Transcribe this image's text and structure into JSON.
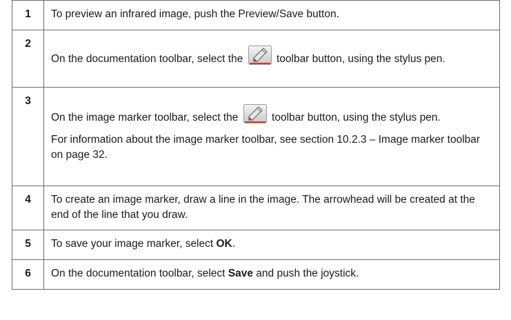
{
  "steps": [
    {
      "number": "1",
      "text": "To preview an infrared image, push the Preview/Save button."
    },
    {
      "number": "2",
      "text_before": "On the documentation toolbar, select the",
      "icon": "pen-toolbar-icon",
      "text_after": "toolbar button, using the stylus pen."
    },
    {
      "number": "3",
      "text_before": "On the image marker toolbar, select the",
      "icon": "pen-toolbar-icon",
      "text_after": "toolbar button, using the stylus pen.",
      "note": "For information about the image marker toolbar, see section 10.2.3 – Image marker toolbar on page 32."
    },
    {
      "number": "4",
      "text": "To create an image marker, draw a line in the image. The arrowhead will be created at the end of the line that you draw."
    },
    {
      "number": "5",
      "text_before": "To save your image marker, select",
      "bold": "OK",
      "text_after": "."
    },
    {
      "number": "6",
      "text_before": "On the documentation toolbar, select",
      "bold": "Save",
      "text_after": "and push the joystick."
    }
  ]
}
